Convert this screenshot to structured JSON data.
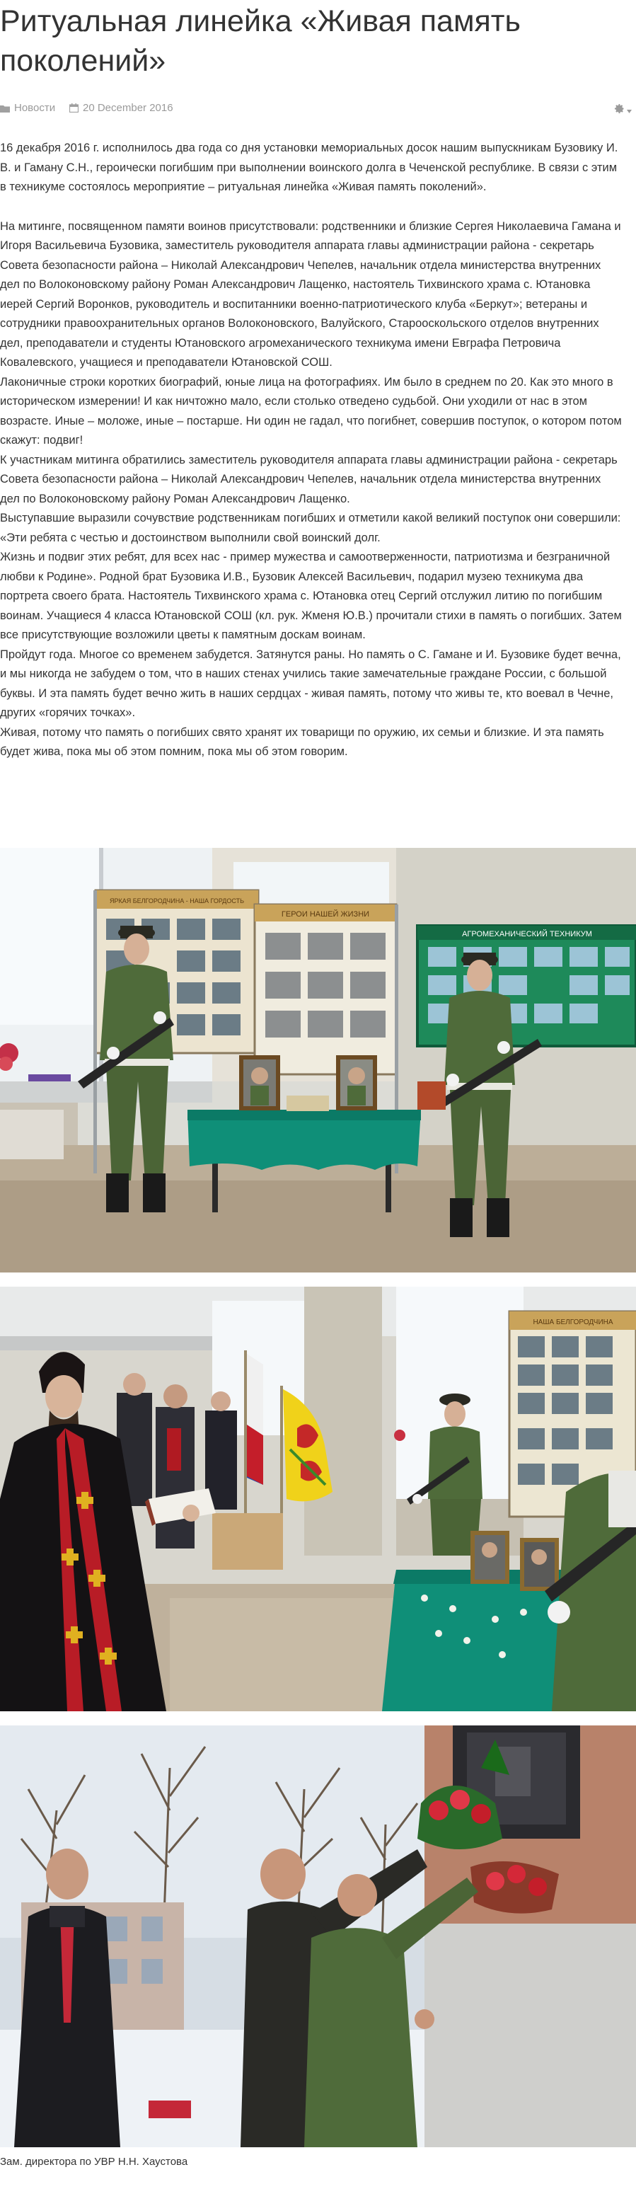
{
  "article": {
    "title": "Ритуальная линейка «Живая память поколений»",
    "category": "Новости",
    "date": "20 December 2016",
    "paragraphs": [
      "16 декабря 2016 г. исполнилось два года со дня установки мемориальных досок нашим выпускникам Бузовику И. В. и Гаману С.Н., героически погибшим при выполнении воинского долга в Чеченской республике. В связи с этим в техникуме состоялось мероприятие – ритуальная линейка «Живая память поколений».",
      "На митинге, посвященном памяти воинов присутствовали: родственники и близкие Сергея Николаевича Гамана и Игоря Васильевича Бузовика, заместитель руководителя аппарата главы администрации района - секретарь Совета безопасности района – Николай Александрович Чепелев, начальник отдела министерства внутренних дел по Волоконовскому району Роман Александрович Лащенко, настоятель Тихвинского храма с. Ютановка иерей Сергий Воронков, руководитель и воспитанники военно-патриотического клуба «Беркут»; ветераны и сотрудники правоохранительных органов Волоконовского, Валуйского, Старооскольского отделов внутренних дел, преподаватели и студенты Ютановского агромеханического техникума имени Евграфа Петровича Ковалевского, учащиеся и преподаватели Ютановской СОШ.",
      "Лаконичные строки коротких биографий, юные лица на фотографиях. Им было в среднем по 20. Как это много в историческом измерении! И как ничтожно мало, если столько отведено судьбой. Они уходили от нас в этом возрасте. Иные – моложе, иные – постарше. Ни один не гадал, что погибнет, совершив поступок, о котором потом скажут: подвиг!",
      "К участникам митинга обратились заместитель руководителя аппарата главы администрации района - секретарь Совета безопасности района – Николай Александрович Чепелев, начальник отдела министерства внутренних дел по Волоконовскому району Роман Александрович Лащенко.",
      "Выступавшие выразили сочувствие родственникам погибших и отметили какой великий поступок они совершили: «Эти ребята с честью и достоинством выполнили свой воинский долг.",
      "Жизнь и подвиг этих ребят, для всех нас - пример мужества и самоотверженности, патриотизма и безграничной любви к Родине». Родной брат Бузовика И.В., Бузовик Алексей Васильевич, подарил музею техникума два портрета своего брата. Настоятель Тихвинского храма с. Ютановка отец Сергий отслужил литию по погибшим воинам. Учащиеся 4 класса Ютановской СОШ (кл. рук. Жменя Ю.В.) прочитали стихи в память о погибших. Затем все присутствующие возложили цветы к памятным доскам воинам.",
      "Пройдут года. Многое со временем забудется. Затянутся раны. Но память о С. Гамане и И. Бузовике будет вечна, и мы никогда не забудем о том, что в наших стенах учились такие замечательные граждане России, с большой буквы. И эта память будет вечно жить в наших сердцах - живая память, потому что живы те, кто воевал в Чечне, других «горячих точках».",
      "Живая, потому что память о погибших свято хранят их товарищи по оружию, их семьи и близкие. И эта память будет жива, пока мы об этом помним, пока мы об этом говорим."
    ],
    "photo1": {
      "board_left": "ЯРКАЯ БЕЛГОРОДЧИНА - НАША ГОРДОСТЬ",
      "board_middle": "ГЕРОИ НАШЕЙ ЖИЗНИ",
      "board_right": "АГРОМЕХАНИЧЕСКИЙ ТЕХНИКУМ"
    },
    "photo2": {
      "board": "НАША БЕЛГОРОДЧИНА"
    },
    "caption": "Зам. директора по УВР Н.Н. Хаустова"
  },
  "colors": {
    "text": "#333333",
    "muted": "#9a9a9a",
    "cloth": "#0f8f78",
    "uniform": "#4f6b3a",
    "vestment": "#b81c26"
  },
  "icons": {
    "category": "folder-icon",
    "date": "calendar-icon",
    "tools": "gear-icon"
  }
}
